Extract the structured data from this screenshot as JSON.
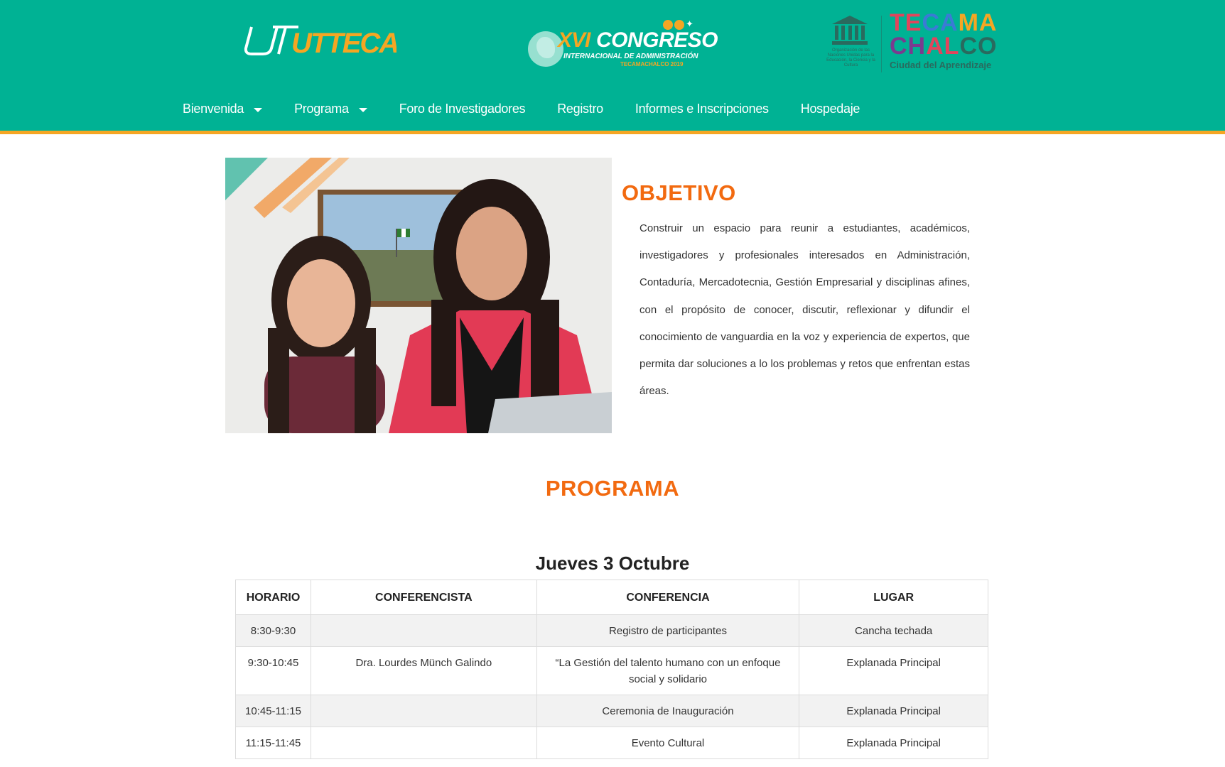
{
  "header": {
    "logo_left_text": "UTTECAM",
    "congreso": {
      "number": "XVI",
      "title": "CONGRESO",
      "subtitle": "INTERNACIONAL DE ADMINISTRACIÓN",
      "place": "TECAMACHALCO 2019"
    },
    "unesco_caption": "Organización de las Naciones Unidas para la Educación, la Ciencia y la Cultura",
    "city_logo": {
      "line1_parts": [
        "TE",
        "CA",
        "MA"
      ],
      "line2_parts": [
        "CH",
        "AL",
        "CO"
      ],
      "tagline": "Ciudad del Aprendizaje"
    },
    "colors": {
      "header_bg": "#00b294",
      "accent": "#f5a623",
      "title": "#f26a10"
    }
  },
  "nav": {
    "items": [
      {
        "label": "Bienvenida",
        "dropdown": true
      },
      {
        "label": "Programa",
        "dropdown": true
      },
      {
        "label": "Foro de Investigadores",
        "dropdown": false
      },
      {
        "label": "Registro",
        "dropdown": false
      },
      {
        "label": "Informes e Inscripciones",
        "dropdown": false
      },
      {
        "label": "Hospedaje",
        "dropdown": false
      }
    ]
  },
  "objetivo": {
    "title": "OBJETIVO",
    "text": "Construir un espacio para reunir a estudiantes, académicos, investigadores y profesionales interesados en Administración, Contaduría, Mercadotecnia, Gestión Empresarial y disciplinas afines, con el propósito de conocer, discutir, reflexionar y difundir el conocimiento de vanguardia en la voz y experiencia de expertos, que permita dar soluciones a lo los problemas y retos que enfrentan estas áreas."
  },
  "programa": {
    "title": "PROGRAMA",
    "day": "Jueves 3 Octubre",
    "columns": [
      "HORARIO",
      "CONFERENCISTA",
      "CONFERENCIA",
      "LUGAR"
    ],
    "rows": [
      [
        "8:30-9:30",
        "",
        "Registro de participantes",
        "Cancha techada"
      ],
      [
        "9:30-10:45",
        "Dra. Lourdes Münch Galindo",
        "“La Gestión del talento humano con un enfoque social y solidario",
        "Explanada Principal"
      ],
      [
        "10:45-11:15",
        "",
        "Ceremonia de Inauguración",
        "Explanada Principal"
      ],
      [
        "11:15-11:45",
        "",
        "Evento Cultural",
        "Explanada Principal"
      ]
    ]
  }
}
